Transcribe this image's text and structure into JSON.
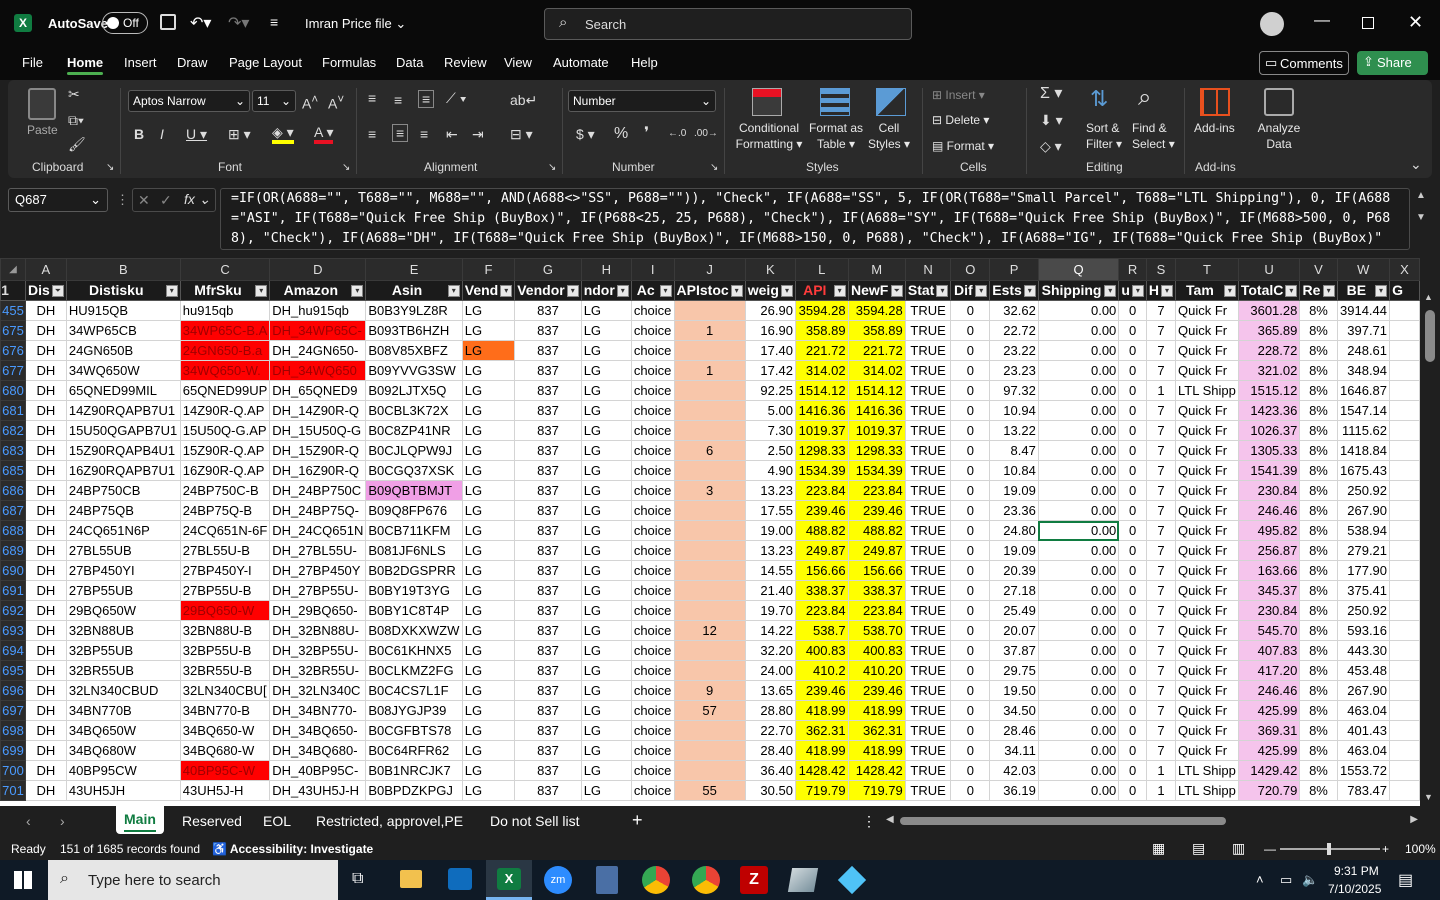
{
  "titlebar": {
    "autosave": "AutoSave",
    "toggle": "Off",
    "filename": "Imran Price file",
    "search_placeholder": "Search"
  },
  "menu": [
    "File",
    "Home",
    "Insert",
    "Draw",
    "Page Layout",
    "Formulas",
    "Data",
    "Review",
    "View",
    "Automate",
    "Help"
  ],
  "menu_active": "Home",
  "comments_label": "Comments",
  "share_label": "Share",
  "ribbon": {
    "clipboard": {
      "label": "Clipboard",
      "paste": "Paste"
    },
    "font": {
      "label": "Font",
      "name": "Aptos Narrow",
      "size": "11"
    },
    "alignment": {
      "label": "Alignment"
    },
    "number": {
      "label": "Number",
      "format": "Number"
    },
    "styles": {
      "label": "Styles",
      "conditional": [
        "Conditional",
        "Formatting"
      ],
      "format_table": [
        "Format as",
        "Table"
      ],
      "cell_styles": [
        "Cell",
        "Styles"
      ]
    },
    "cells": {
      "label": "Cells",
      "insert": "Insert",
      "delete": "Delete",
      "format": "Format"
    },
    "editing": {
      "label": "Editing",
      "sort": [
        "Sort &",
        "Filter"
      ],
      "find": [
        "Find &",
        "Select"
      ]
    },
    "addins": {
      "label": "Add-ins",
      "addins": "Add-ins",
      "analyze": [
        "Analyze",
        "Data"
      ]
    }
  },
  "formula_bar": {
    "name_box": "Q687",
    "formula": "=IF(OR(A688=\"\", T688=\"\", M688=\"\", AND(A688<>\"SS\", P688=\"\")), \"Check\", IF(A688=\"SS\", 5, IF(OR(T688=\"Small Parcel\", T688=\"LTL Shipping\"), 0, IF(A688=\"ASI\", IF(T688=\"Quick Free Ship (BuyBox)\", IF(P688<25, 25, P688), \"Check\"), IF(A688=\"SY\", IF(T688=\"Quick Free Ship (BuyBox)\", IF(M688>500, 0, P688), \"Check\"), IF(A688=\"DH\", IF(T688=\"Quick Free Ship (BuyBox)\", IF(M688>150, 0, P688), \"Check\"), IF(A688=\"IG\", IF(T688=\"Quick Free Ship (BuyBox)\""
  },
  "columns": [
    "A",
    "B",
    "C",
    "D",
    "E",
    "F",
    "G",
    "H",
    "I",
    "J",
    "K",
    "L",
    "M",
    "N",
    "O",
    "P",
    "Q",
    "R",
    "S",
    "T",
    "U",
    "V",
    "W",
    "X"
  ],
  "headers": [
    "Dis",
    "Distisku",
    "MfrSku",
    "Amazon",
    "Asin",
    "Vend",
    "Vendor",
    "ndor",
    "Ac",
    "APIstoc",
    "weig",
    "API",
    "NewF",
    "Stat",
    "Dif",
    "Ests",
    "Shipping",
    "u",
    "H",
    "Tam",
    "TotalC",
    "Re",
    "BE",
    "G"
  ],
  "rows": [
    [
      "455",
      "DH",
      "HU915QB",
      "hu915qb",
      "DH_hu915qb",
      "B0B3Y9LZ8R",
      "LG",
      "837",
      "LG",
      "choice",
      "",
      "26.90",
      "3594.28",
      "3594.28",
      "TRUE",
      "0",
      "32.62",
      "0.00",
      "0",
      "7",
      "Quick Fr",
      "3601.28",
      "8%",
      "3914.44"
    ],
    [
      "675",
      "DH",
      "34WP65CB",
      "34WP65C-B.A",
      "DH_34WP65C-",
      "B093TB6HZH",
      "LG",
      "837",
      "LG",
      "choice",
      "1",
      "16.90",
      "358.89",
      "358.89",
      "TRUE",
      "0",
      "22.72",
      "0.00",
      "0",
      "7",
      "Quick Fr",
      "365.89",
      "8%",
      "397.71"
    ],
    [
      "676",
      "DH",
      "24GN650B",
      "24GN650-B.a",
      "DH_24GN650-",
      "B08V85XBFZ",
      "LG",
      "837",
      "LG",
      "choice",
      "",
      "17.40",
      "221.72",
      "221.72",
      "TRUE",
      "0",
      "23.22",
      "0.00",
      "0",
      "7",
      "Quick Fr",
      "228.72",
      "8%",
      "248.61"
    ],
    [
      "677",
      "DH",
      "34WQ650W",
      "34WQ650-W.",
      "DH_34WQ650",
      "B09YVVG3SW",
      "LG",
      "837",
      "LG",
      "choice",
      "1",
      "17.42",
      "314.02",
      "314.02",
      "TRUE",
      "0",
      "23.23",
      "0.00",
      "0",
      "7",
      "Quick Fr",
      "321.02",
      "8%",
      "348.94"
    ],
    [
      "680",
      "DH",
      "65QNED99MIL",
      "65QNED99UP",
      "DH_65QNED9",
      "B092LJTX5Q",
      "LG",
      "837",
      "LG",
      "choice",
      "",
      "92.25",
      "1514.12",
      "1514.12",
      "TRUE",
      "0",
      "97.32",
      "0.00",
      "0",
      "1",
      "LTL Shipp",
      "1515.12",
      "8%",
      "1646.87"
    ],
    [
      "681",
      "DH",
      "14Z90RQAPB7U1",
      "14Z90R-Q.AP",
      "DH_14Z90R-Q",
      "B0CBL3K72X",
      "LG",
      "837",
      "LG",
      "choice",
      "",
      "5.00",
      "1416.36",
      "1416.36",
      "TRUE",
      "0",
      "10.94",
      "0.00",
      "0",
      "7",
      "Quick Fr",
      "1423.36",
      "8%",
      "1547.14"
    ],
    [
      "682",
      "DH",
      "15U50QGAPB7U1",
      "15U50Q-G.AP",
      "DH_15U50Q-G",
      "B0C8ZP41NR",
      "LG",
      "837",
      "LG",
      "choice",
      "",
      "7.30",
      "1019.37",
      "1019.37",
      "TRUE",
      "0",
      "13.22",
      "0.00",
      "0",
      "7",
      "Quick Fr",
      "1026.37",
      "8%",
      "1115.62"
    ],
    [
      "683",
      "DH",
      "15Z90RQAPB4U1",
      "15Z90R-Q.AP",
      "DH_15Z90R-Q",
      "B0CJLQPW9J",
      "LG",
      "837",
      "LG",
      "choice",
      "6",
      "2.50",
      "1298.33",
      "1298.33",
      "TRUE",
      "0",
      "8.47",
      "0.00",
      "0",
      "7",
      "Quick Fr",
      "1305.33",
      "8%",
      "1418.84"
    ],
    [
      "685",
      "DH",
      "16Z90RQAPB7U1",
      "16Z90R-Q.AP",
      "DH_16Z90R-Q",
      "B0CGQ37XSK",
      "LG",
      "837",
      "LG",
      "choice",
      "",
      "4.90",
      "1534.39",
      "1534.39",
      "TRUE",
      "0",
      "10.84",
      "0.00",
      "0",
      "7",
      "Quick Fr",
      "1541.39",
      "8%",
      "1675.43"
    ],
    [
      "686",
      "DH",
      "24BP750CB",
      "24BP750C-B",
      "DH_24BP750C",
      "B09QBTBMJT",
      "LG",
      "837",
      "LG",
      "choice",
      "3",
      "13.23",
      "223.84",
      "223.84",
      "TRUE",
      "0",
      "19.09",
      "0.00",
      "0",
      "7",
      "Quick Fr",
      "230.84",
      "8%",
      "250.92"
    ],
    [
      "687",
      "DH",
      "24BP75QB",
      "24BP75Q-B",
      "DH_24BP75Q-",
      "B09Q8FP676",
      "LG",
      "837",
      "LG",
      "choice",
      "",
      "17.55",
      "239.46",
      "239.46",
      "TRUE",
      "0",
      "23.36",
      "0.00",
      "0",
      "7",
      "Quick Fr",
      "246.46",
      "8%",
      "267.90"
    ],
    [
      "688",
      "DH",
      "24CQ651N6P",
      "24CQ651N-6F",
      "DH_24CQ651N",
      "B0CB711KFM",
      "LG",
      "837",
      "LG",
      "choice",
      "",
      "19.00",
      "488.82",
      "488.82",
      "TRUE",
      "0",
      "24.80",
      "0.00",
      "0",
      "7",
      "Quick Fr",
      "495.82",
      "8%",
      "538.94"
    ],
    [
      "689",
      "DH",
      "27BL55UB",
      "27BL55U-B",
      "DH_27BL55U-",
      "B081JF6NLS",
      "LG",
      "837",
      "LG",
      "choice",
      "",
      "13.23",
      "249.87",
      "249.87",
      "TRUE",
      "0",
      "19.09",
      "0.00",
      "0",
      "7",
      "Quick Fr",
      "256.87",
      "8%",
      "279.21"
    ],
    [
      "690",
      "DH",
      "27BP450YI",
      "27BP450Y-I",
      "DH_27BP450Y",
      "B0B2DGSPRR",
      "LG",
      "837",
      "LG",
      "choice",
      "",
      "14.55",
      "156.66",
      "156.66",
      "TRUE",
      "0",
      "20.39",
      "0.00",
      "0",
      "7",
      "Quick Fr",
      "163.66",
      "8%",
      "177.90"
    ],
    [
      "691",
      "DH",
      "27BP55UB",
      "27BP55U-B",
      "DH_27BP55U-",
      "B0BY19T3YG",
      "LG",
      "837",
      "LG",
      "choice",
      "",
      "21.40",
      "338.37",
      "338.37",
      "TRUE",
      "0",
      "27.18",
      "0.00",
      "0",
      "7",
      "Quick Fr",
      "345.37",
      "8%",
      "375.41"
    ],
    [
      "692",
      "DH",
      "29BQ650W",
      "29BQ650-W",
      "DH_29BQ650-",
      "B0BY1C8T4P",
      "LG",
      "837",
      "LG",
      "choice",
      "",
      "19.70",
      "223.84",
      "223.84",
      "TRUE",
      "0",
      "25.49",
      "0.00",
      "0",
      "7",
      "Quick Fr",
      "230.84",
      "8%",
      "250.92"
    ],
    [
      "693",
      "DH",
      "32BN88UB",
      "32BN88U-B",
      "DH_32BN88U-",
      "B08DXKXWZW",
      "LG",
      "837",
      "LG",
      "choice",
      "12",
      "14.22",
      "538.7",
      "538.70",
      "TRUE",
      "0",
      "20.07",
      "0.00",
      "0",
      "7",
      "Quick Fr",
      "545.70",
      "8%",
      "593.16"
    ],
    [
      "694",
      "DH",
      "32BP55UB",
      "32BP55U-B",
      "DH_32BP55U-",
      "B0C61KHNX5",
      "LG",
      "837",
      "LG",
      "choice",
      "",
      "32.20",
      "400.83",
      "400.83",
      "TRUE",
      "0",
      "37.87",
      "0.00",
      "0",
      "7",
      "Quick Fr",
      "407.83",
      "8%",
      "443.30"
    ],
    [
      "695",
      "DH",
      "32BR55UB",
      "32BR55U-B",
      "DH_32BR55U-",
      "B0CLKMZ2FG",
      "LG",
      "837",
      "LG",
      "choice",
      "",
      "24.00",
      "410.2",
      "410.20",
      "TRUE",
      "0",
      "29.75",
      "0.00",
      "0",
      "7",
      "Quick Fr",
      "417.20",
      "8%",
      "453.48"
    ],
    [
      "696",
      "DH",
      "32LN340CBUD",
      "32LN340CBU[",
      "DH_32LN340C",
      "B0C4CS7L1F",
      "LG",
      "837",
      "LG",
      "choice",
      "9",
      "13.65",
      "239.46",
      "239.46",
      "TRUE",
      "0",
      "19.50",
      "0.00",
      "0",
      "7",
      "Quick Fr",
      "246.46",
      "8%",
      "267.90"
    ],
    [
      "697",
      "DH",
      "34BN770B",
      "34BN770-B",
      "DH_34BN770-",
      "B08JYGJP39",
      "LG",
      "837",
      "LG",
      "choice",
      "57",
      "28.80",
      "418.99",
      "418.99",
      "TRUE",
      "0",
      "34.50",
      "0.00",
      "0",
      "7",
      "Quick Fr",
      "425.99",
      "8%",
      "463.04"
    ],
    [
      "698",
      "DH",
      "34BQ650W",
      "34BQ650-W",
      "DH_34BQ650-",
      "B0CGFBTS78",
      "LG",
      "837",
      "LG",
      "choice",
      "",
      "22.70",
      "362.31",
      "362.31",
      "TRUE",
      "0",
      "28.46",
      "0.00",
      "0",
      "7",
      "Quick Fr",
      "369.31",
      "8%",
      "401.43"
    ],
    [
      "699",
      "DH",
      "34BQ680W",
      "34BQ680-W",
      "DH_34BQ680-",
      "B0C64RFR62",
      "LG",
      "837",
      "LG",
      "choice",
      "",
      "28.40",
      "418.99",
      "418.99",
      "TRUE",
      "0",
      "34.11",
      "0.00",
      "0",
      "7",
      "Quick Fr",
      "425.99",
      "8%",
      "463.04"
    ],
    [
      "700",
      "DH",
      "40BP95CW",
      "40BP95C-W",
      "DH_40BP95C-",
      "B0B1NRCJK7",
      "LG",
      "837",
      "LG",
      "choice",
      "",
      "36.40",
      "1428.42",
      "1428.42",
      "TRUE",
      "0",
      "42.03",
      "0.00",
      "0",
      "1",
      "LTL Shipp",
      "1429.42",
      "8%",
      "1553.72"
    ],
    [
      "701",
      "DH",
      "43UH5JH",
      "43UH5J-H",
      "DH_43UH5J-H",
      "B0BPDZKPGJ",
      "LG",
      "837",
      "LG",
      "choice",
      "55",
      "30.50",
      "719.79",
      "719.79",
      "TRUE",
      "0",
      "36.19",
      "0.00",
      "0",
      "1",
      "LTL Shipp",
      "720.79",
      "8%",
      "783.47"
    ]
  ],
  "tabs": [
    "Main",
    "Reserved",
    "EOL",
    "Restricted, approvel,PE",
    "Do not Sell list"
  ],
  "tab_active": "Main",
  "status": {
    "ready": "Ready",
    "records": "151 of 1685 records found",
    "accessibility": "Accessibility: Investigate",
    "zoom": "100%"
  },
  "taskbar": {
    "search_placeholder": "Type here to search",
    "time": "9:31 PM",
    "date": "7/10/2025"
  },
  "colors": {
    "excel_green": "#107c41",
    "share_green": "#2f8f4f",
    "row_red": "#ff0000",
    "orange": "#ff6d1a",
    "pink": "#f09fe6",
    "peach": "#f8c6aa",
    "yellow": "#ffff00",
    "light_pink": "#f5c4ec"
  }
}
